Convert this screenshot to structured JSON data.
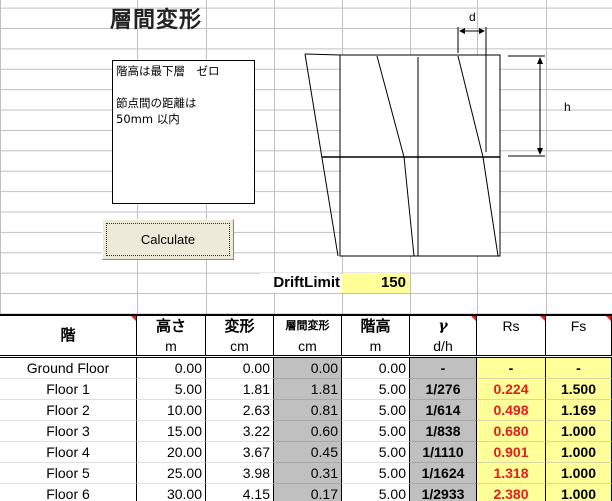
{
  "title": "層間変形",
  "note": [
    "階高は最下層　ゼロ",
    "",
    "節点間の距離は",
    "50mm 以内"
  ],
  "calculate_label": "Calculate",
  "drift_limit": {
    "label": "DriftLimit",
    "value": "150"
  },
  "diagram": {
    "d_label": "d",
    "h_label": "h"
  },
  "table": {
    "headers": [
      {
        "top": "階",
        "unit": ""
      },
      {
        "top": "高さ",
        "unit": "m"
      },
      {
        "top": "変形",
        "unit": "cm"
      },
      {
        "top": "層間変形",
        "unit": "cm"
      },
      {
        "top": "階高",
        "unit": "m"
      },
      {
        "top": "γ",
        "unit": "d/h"
      },
      {
        "top": "Rs",
        "unit": ""
      },
      {
        "top": "Fs",
        "unit": ""
      }
    ],
    "rows": [
      [
        "Ground Floor",
        "0.00",
        "0.00",
        "0.00",
        "0.00",
        "-",
        "-",
        "-"
      ],
      [
        "Floor  1",
        "5.00",
        "1.81",
        "1.81",
        "5.00",
        "1/276",
        "0.224",
        "1.500"
      ],
      [
        "Floor  2",
        "10.00",
        "2.63",
        "0.81",
        "5.00",
        "1/614",
        "0.498",
        "1.169"
      ],
      [
        "Floor  3",
        "15.00",
        "3.22",
        "0.60",
        "5.00",
        "1/838",
        "0.680",
        "1.000"
      ],
      [
        "Floor  4",
        "20.00",
        "3.67",
        "0.45",
        "5.00",
        "1/1110",
        "0.901",
        "1.000"
      ],
      [
        "Floor  5",
        "25.00",
        "3.98",
        "0.31",
        "5.00",
        "1/1624",
        "1.318",
        "1.000"
      ],
      [
        "Floor  6",
        "30.00",
        "4.15",
        "0.17",
        "5.00",
        "1/2933",
        "2.380",
        "1.000"
      ]
    ]
  },
  "colors": {
    "gray": "#c0c0c0",
    "yellow": "#ffff99",
    "red": "#e02020"
  }
}
